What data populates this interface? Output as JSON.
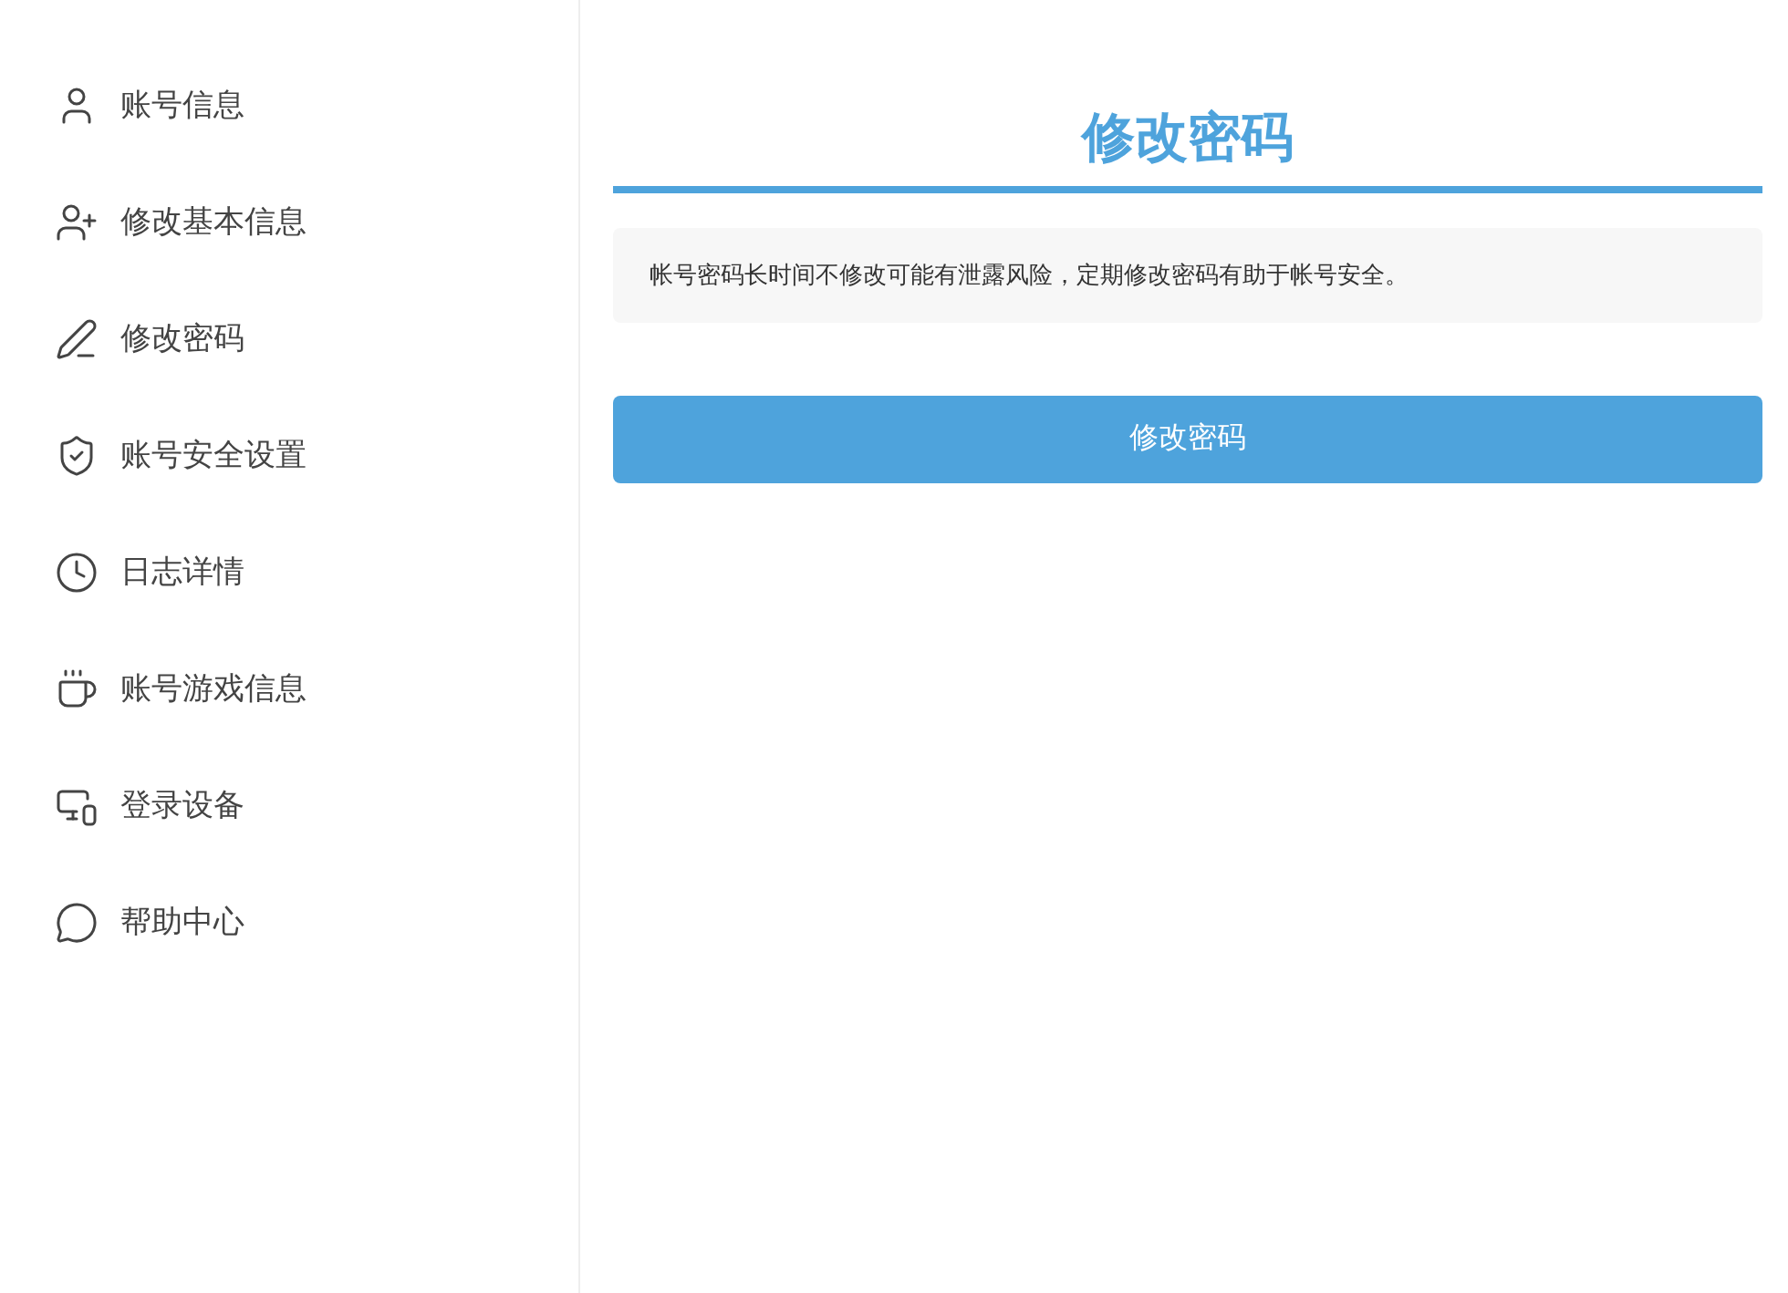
{
  "sidebar": {
    "items": [
      {
        "kind": "user",
        "label": "账号信息"
      },
      {
        "kind": "user-plus",
        "label": "修改基本信息"
      },
      {
        "kind": "pen",
        "label": "修改密码"
      },
      {
        "kind": "shield",
        "label": "账号安全设置"
      },
      {
        "kind": "clock",
        "label": "日志详情"
      },
      {
        "kind": "cup",
        "label": "账号游戏信息"
      },
      {
        "kind": "devices",
        "label": "登录设备"
      },
      {
        "kind": "chat",
        "label": "帮助中心"
      }
    ]
  },
  "main": {
    "title": "修改密码",
    "notice": "帐号密码长时间不修改可能有泄露风险，定期修改密码有助于帐号安全。",
    "button": "修改密码"
  }
}
